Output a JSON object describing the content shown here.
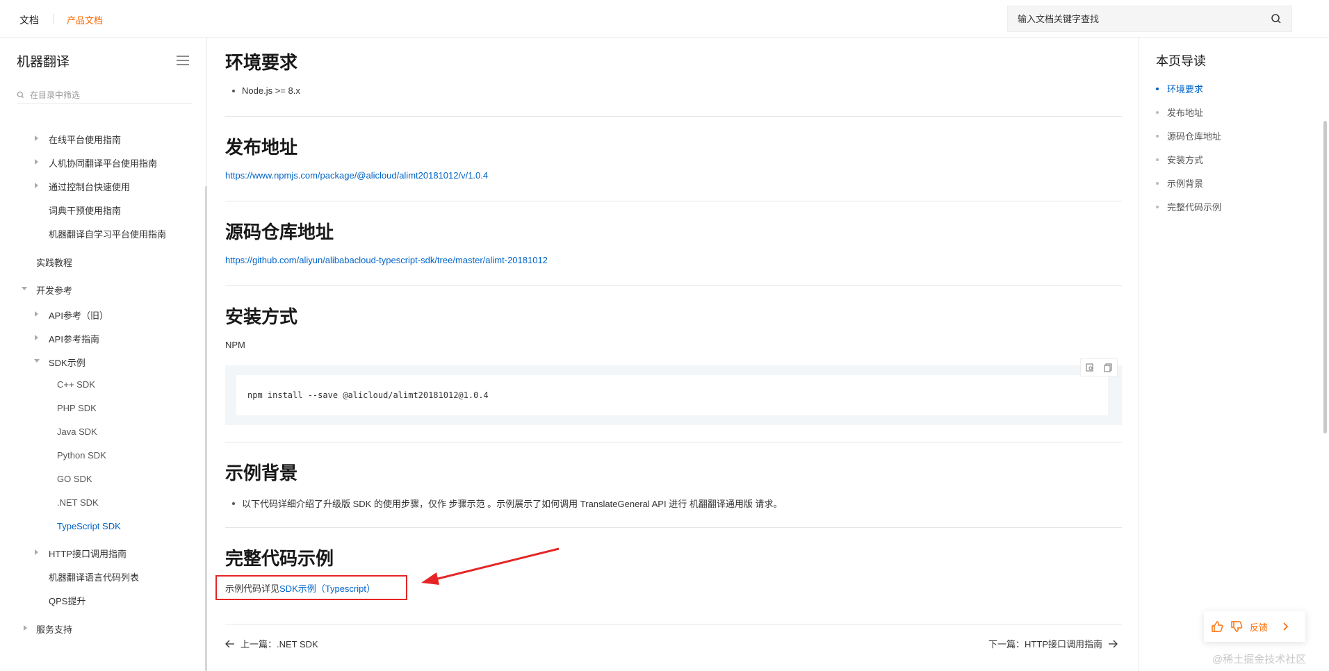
{
  "topbar": {
    "brand": "文档",
    "product": "产品文档",
    "search_placeholder": "输入文档关键字查找"
  },
  "sidebar": {
    "title": "机器翻译",
    "filter_placeholder": "在目录中筛选",
    "items": [
      {
        "label": "在线平台使用指南"
      },
      {
        "label": "人机协同翻译平台使用指南"
      },
      {
        "label": "通过控制台快速使用"
      },
      {
        "label": "词典干预使用指南"
      },
      {
        "label": "机器翻译自学习平台使用指南"
      },
      {
        "label": "实践教程"
      },
      {
        "label": "开发参考"
      },
      {
        "label": "API参考（旧）"
      },
      {
        "label": "API参考指南"
      },
      {
        "label": "SDK示例"
      },
      {
        "label": "C++ SDK"
      },
      {
        "label": "PHP SDK"
      },
      {
        "label": "Java SDK"
      },
      {
        "label": "Python SDK"
      },
      {
        "label": "GO SDK"
      },
      {
        "label": ".NET SDK"
      },
      {
        "label": "TypeScript SDK"
      },
      {
        "label": "HTTP接口调用指南"
      },
      {
        "label": "机器翻译语言代码列表"
      },
      {
        "label": "QPS提升"
      },
      {
        "label": "服务支持"
      }
    ]
  },
  "main": {
    "sections": [
      {
        "title": "环境要求"
      },
      {
        "title": "发布地址"
      },
      {
        "title": "源码仓库地址"
      },
      {
        "title": "安装方式"
      },
      {
        "title": "示例背景"
      },
      {
        "title": "完整代码示例"
      }
    ],
    "env_bullet": "Node.js >= 8.x",
    "publish_link": "https://www.npmjs.com/package/@alicloud/alimt20181012/v/1.0.4",
    "repo_link": "https://github.com/aliyun/alibabacloud-typescript-sdk/tree/master/alimt-20181012",
    "install_label": "NPM",
    "install_code": "npm install --save @alicloud/alimt20181012@1.0.4",
    "bg_bullet": "以下代码详细介绍了升级版 SDK 的使用步骤，仅作 步骤示范 。示例展示了如何调用 TranslateGeneral API 进行 机翻翻译通用版 请求。",
    "code_prefix": "示例代码详见",
    "code_link": "SDK示例（Typescript）",
    "prev": "上一篇：.NET SDK",
    "next": "下一篇：HTTP接口调用指南"
  },
  "toc": {
    "title": "本页导读",
    "items": [
      "环境要求",
      "发布地址",
      "源码仓库地址",
      "安装方式",
      "示例背景",
      "完整代码示例"
    ]
  },
  "feedback": {
    "label": "反馈"
  },
  "watermark": "@稀土掘金技术社区",
  "colors": {
    "accent": "#0064c8",
    "brand": "#ff6a00",
    "annotation": "#e52525"
  }
}
